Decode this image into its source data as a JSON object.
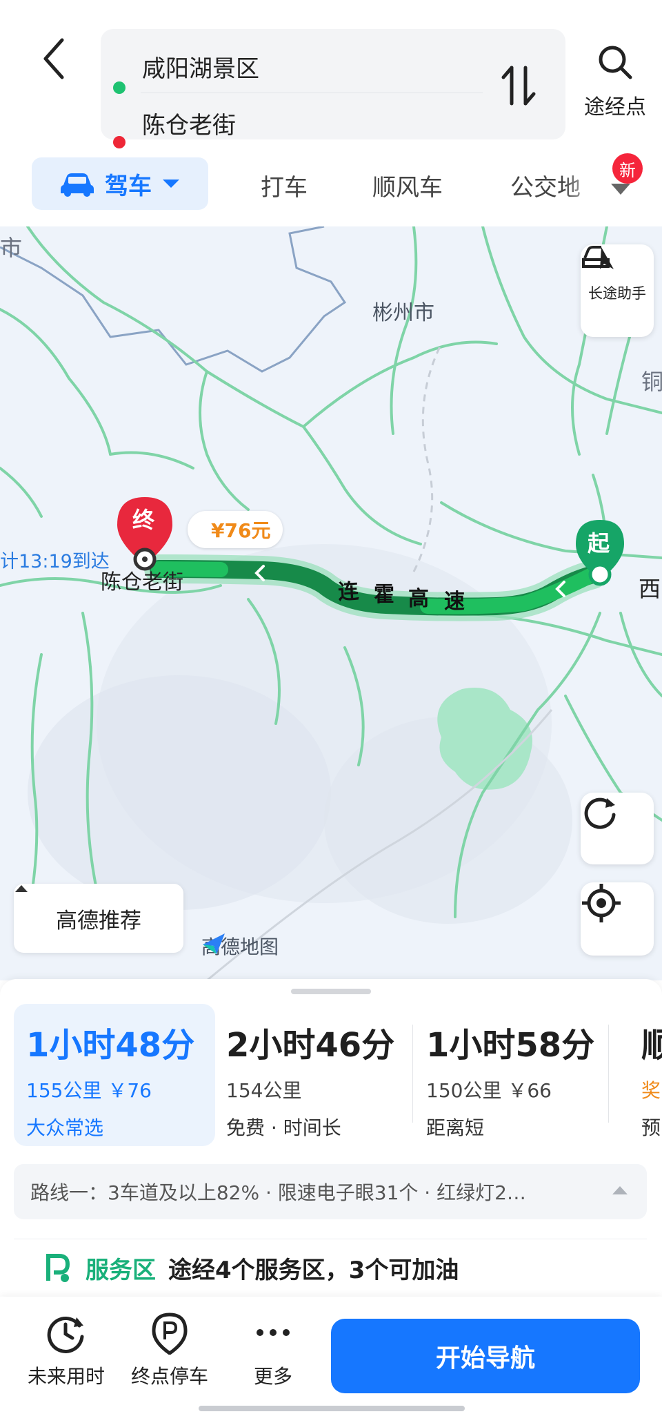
{
  "header": {
    "start_location": "咸阳湖景区",
    "end_location": "陈仓老街",
    "waypoint_label": "途经点"
  },
  "modes": {
    "drive": "驾车",
    "taxi": "打车",
    "carpool": "顺风车",
    "transit": "公交地",
    "new_badge": "新"
  },
  "map": {
    "long_trip_label": "长途助手",
    "recommend_label": "高德推荐",
    "logo_text": "高德地图",
    "fee_tag": "¥76元",
    "arrive_tip": "计13:19到达",
    "end_pin": "终",
    "start_pin": "起",
    "end_label": "陈仓老街",
    "highway_chars": [
      "连",
      "霍",
      "高",
      "速"
    ],
    "city_binzhou": "彬州市",
    "city_xi": "西",
    "city_tong": "铜",
    "city_edge": "市",
    "route_color": "#1fbf5f",
    "route_dark_color": "#178a49"
  },
  "routes": [
    {
      "time": "1小时48分",
      "distance": "155公里 ￥76",
      "tag": "大众常选"
    },
    {
      "time": "2小时46分",
      "distance": "154公里",
      "tag": "免费 · 时间长"
    },
    {
      "time": "1小时58分",
      "distance": "150公里 ￥66",
      "tag": "距离短"
    },
    {
      "time": "顺",
      "distance": "奖",
      "tag": "预"
    }
  ],
  "summary": {
    "text": "路线一：3车道及以上82% · 限速电子眼31个 · 红绿灯2…"
  },
  "service": {
    "tag": "服务区",
    "text": "途经4个服务区，3个可加油"
  },
  "bottom_bar": {
    "future_time": "未来用时",
    "dest_parking": "终点停车",
    "more": "更多",
    "start_nav": "开始导航"
  },
  "colors": {
    "accent": "#1677ff",
    "start_dot": "#1ec271",
    "end_dot": "#ee2737",
    "service_green": "#19b07a",
    "fee_orange": "#f08a19"
  }
}
